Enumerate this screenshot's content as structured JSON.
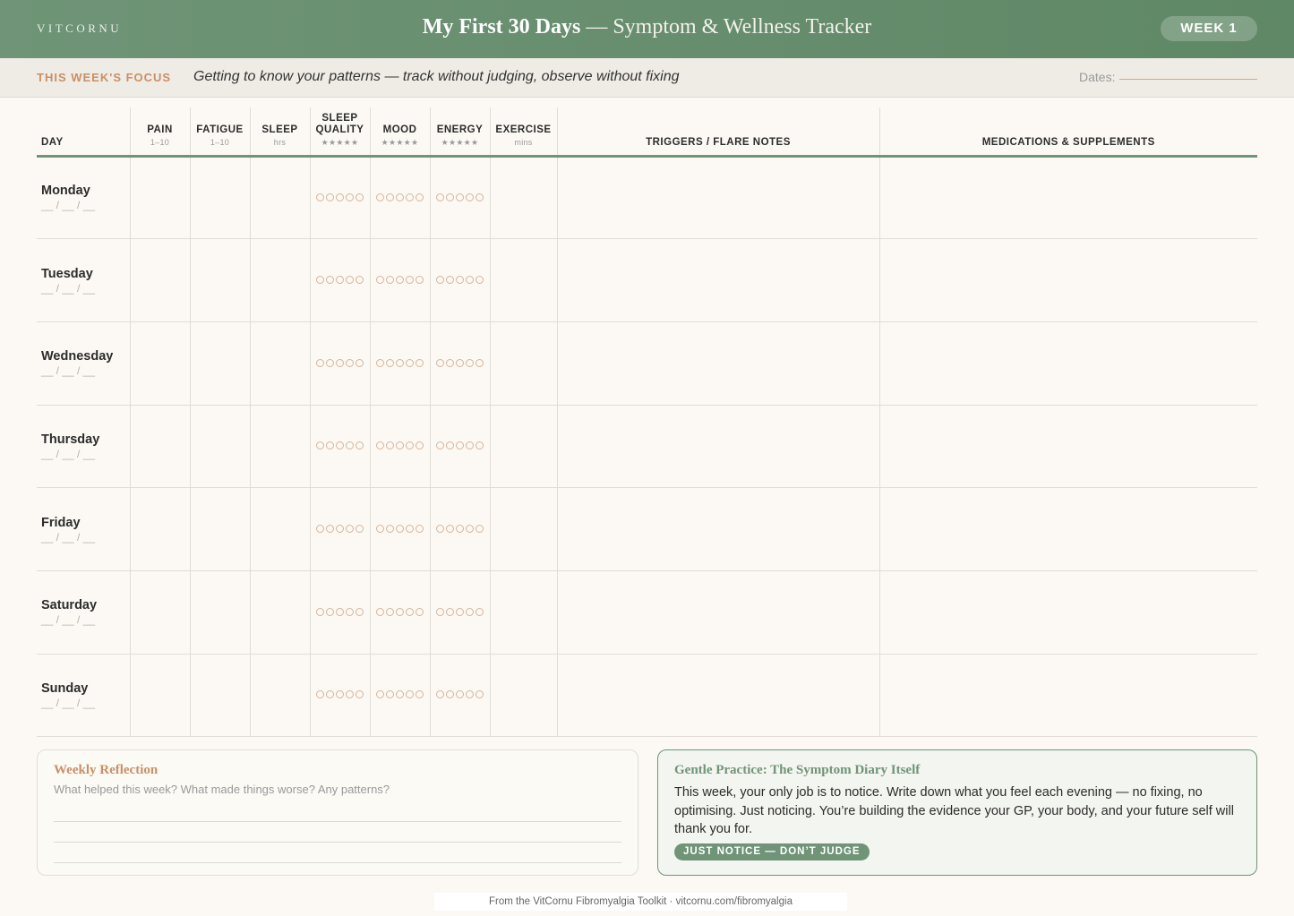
{
  "header": {
    "brand": "VITCORNU",
    "title_bold": "My First 30 Days",
    "title_rest": " — Symptom & Wellness Tracker",
    "week_badge": "WEEK 1"
  },
  "focus": {
    "label": "THIS WEEK'S FOCUS",
    "text": "Getting to know your patterns — track without judging, observe without fixing",
    "dates_label": "Dates:"
  },
  "table": {
    "columns": [
      {
        "label": "DAY",
        "sub": ""
      },
      {
        "label": "PAIN",
        "sub": "1–10"
      },
      {
        "label": "FATIGUE",
        "sub": "1–10"
      },
      {
        "label": "SLEEP",
        "sub": "hrs"
      },
      {
        "label": "SLEEP QUALITY",
        "sub": "★★★★★"
      },
      {
        "label": "MOOD",
        "sub": "★★★★★"
      },
      {
        "label": "ENERGY",
        "sub": "★★★★★"
      },
      {
        "label": "EXERCISE",
        "sub": "mins"
      },
      {
        "label": "TRIGGERS / FLARE NOTES",
        "sub": ""
      },
      {
        "label": "MEDICATIONS & SUPPLEMENTS",
        "sub": ""
      }
    ],
    "days": [
      {
        "name": "Monday",
        "date": "__ / __ / __"
      },
      {
        "name": "Tuesday",
        "date": "__ / __ / __"
      },
      {
        "name": "Wednesday",
        "date": "__ / __ / __"
      },
      {
        "name": "Thursday",
        "date": "__ / __ / __"
      },
      {
        "name": "Friday",
        "date": "__ / __ / __"
      },
      {
        "name": "Saturday",
        "date": "__ / __ / __"
      },
      {
        "name": "Sunday",
        "date": "__ / __ / __"
      }
    ],
    "rating_dots": 5
  },
  "reflection": {
    "title": "Weekly Reflection",
    "prompt": "What helped this week? What made things worse? Any patterns?"
  },
  "practice": {
    "title": "Gentle Practice: The Symptom Diary Itself",
    "text": "This week, your only job is to notice. Write down what you feel each evening — no fixing, no optimising. Just noticing. You’re building the evidence your GP, your body, and your future self will thank you for.",
    "pill": "JUST NOTICE — DON’T JUDGE"
  },
  "footer": "From the VitCornu Fibromyalgia Toolkit · vitcornu.com/fibromyalgia",
  "colors": {
    "accent_green": "#6f9477",
    "accent_terracotta": "#c98f66",
    "background": "#fcf9f4"
  }
}
